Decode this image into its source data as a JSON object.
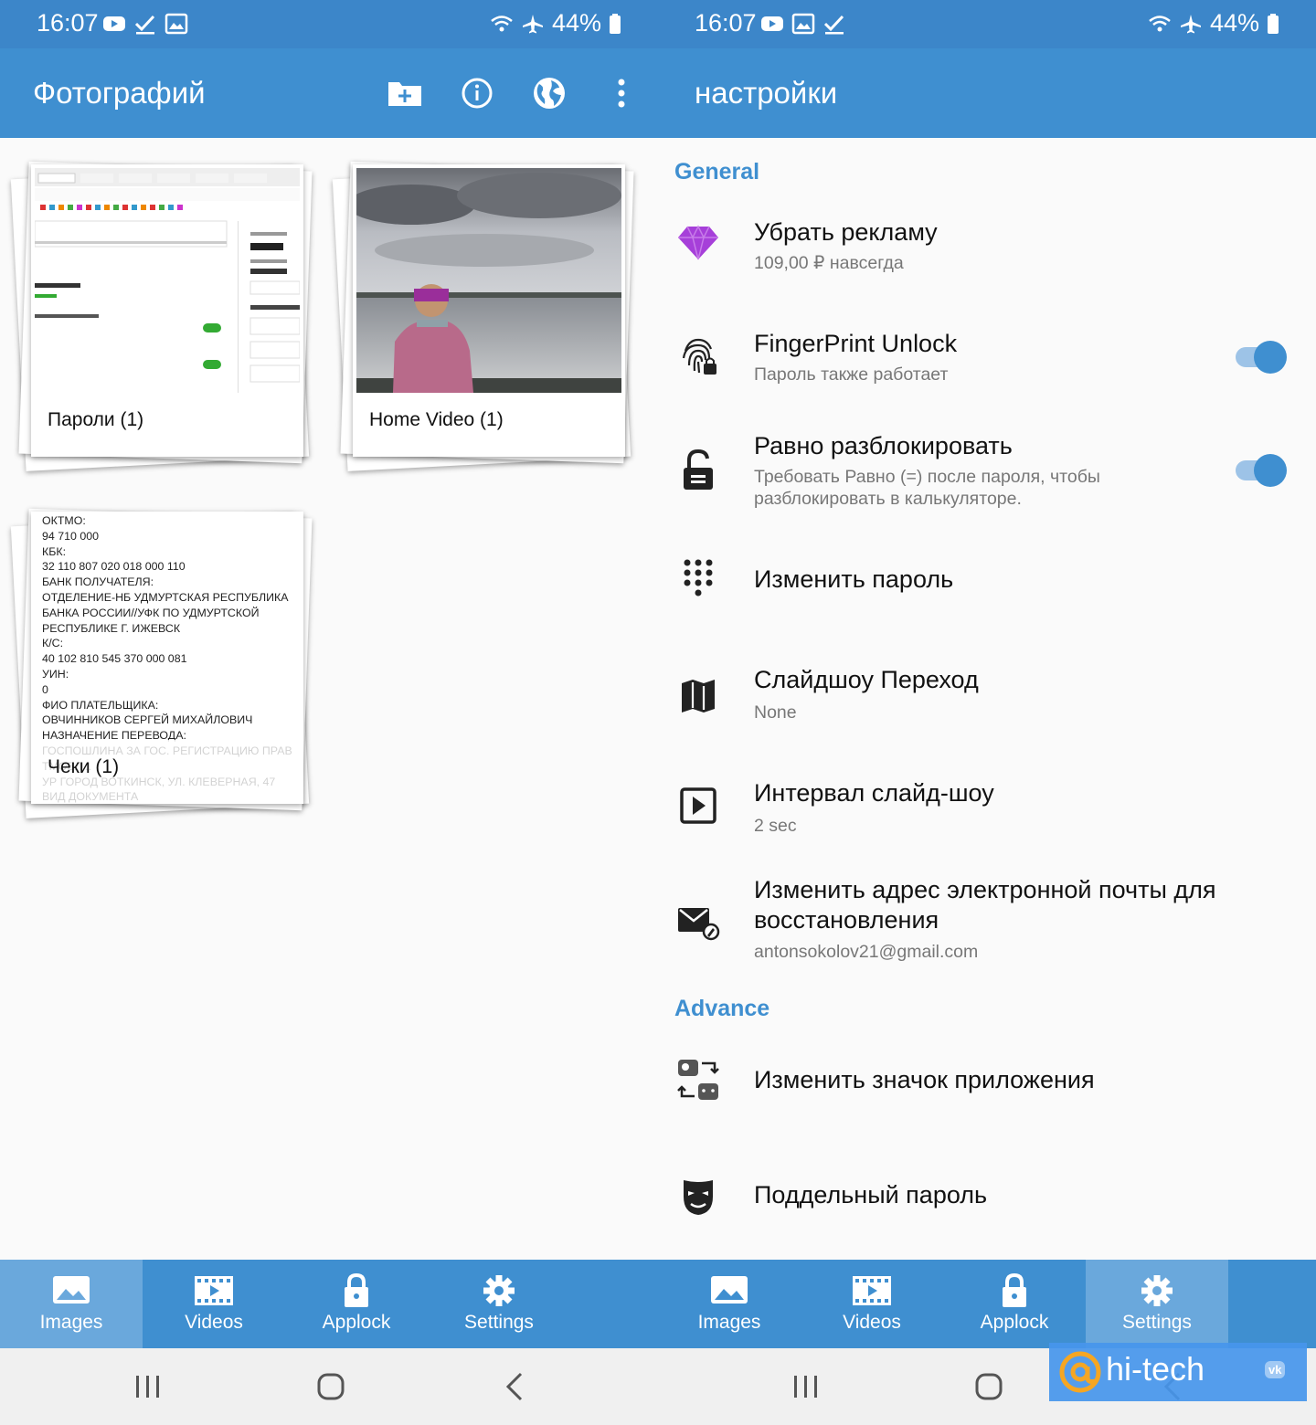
{
  "status": {
    "time": "16:07",
    "battery": "44%"
  },
  "left_screen": {
    "title": "Фотографий",
    "albums": [
      {
        "label": "Пароли (1)"
      },
      {
        "label": "Home Video (1)"
      },
      {
        "label": "Чеки (1)"
      }
    ],
    "receipt_lines": "ОКТМО:\n94 710 000\nКБК:\n32 110 807 020 018 000 110\nБАНК ПОЛУЧАТЕЛЯ:\nОТДЕЛЕНИЕ-НБ УДМУРТСКАЯ РЕСПУБЛИКА\nБАНКА РОССИИ//УФК ПО УДМУРТСКОЙ\nРЕСПУБЛИКЕ Г. ИЖЕВСК\nК/С:\n40 102 810 545 370 000 081\nУИН:\n0\nФИО ПЛАТЕЛЬЩИКА:\nОВЧИННИКОВ СЕРГЕЙ МИХАЙЛОВИЧ\nНАЗНАЧЕНИЕ ПЕРЕВОДА:\nГОСПОШЛИНА ЗА ГОС. РЕГИСТРАЦИЮ ПРАВ\nТМОБЛ...\nУР ГОРОД ВОТКИНСК, УЛ. КЛЕВЕРНАЯ, 47\nВИД ДОКУМЕНТА"
  },
  "right_screen": {
    "title": "настройки",
    "sections": {
      "general": "General",
      "advance": "Advance"
    },
    "settings": [
      {
        "title": "Убрать рекламу",
        "subtitle": "109,00 ₽ навсегда"
      },
      {
        "title": "FingerPrint Unlock",
        "subtitle": "Пароль также работает",
        "toggle": true
      },
      {
        "title": "Равно разблокировать",
        "subtitle": "Требовать Равно (=) после пароля, чтобы разблокировать в калькуляторе.",
        "toggle": true
      },
      {
        "title": "Изменить пароль",
        "subtitle": ""
      },
      {
        "title": "Слайдшоу Переход",
        "subtitle": "None"
      },
      {
        "title": "Интервал слайд-шоу",
        "subtitle": "2 sec"
      },
      {
        "title": "Изменить адрес электронной почты для восстановления",
        "subtitle": "antonsokolov21@gmail.com"
      },
      {
        "title": "Изменить значок приложения",
        "subtitle": ""
      },
      {
        "title": "Поддельный пароль",
        "subtitle": ""
      }
    ]
  },
  "bottom_nav": [
    "Images",
    "Videos",
    "Applock",
    "Settings"
  ],
  "watermark": {
    "text": "hi-tech",
    "badge": "vk"
  },
  "colors": {
    "primary": "#3f8fd0",
    "status": "#3c86c9",
    "nav_active": "#6aa8dc"
  }
}
